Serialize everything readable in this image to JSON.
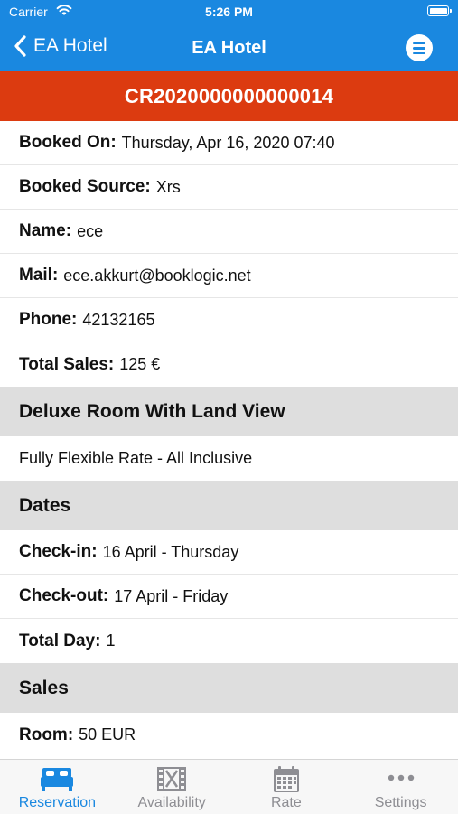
{
  "status_bar": {
    "carrier": "Carrier",
    "time": "5:26 PM"
  },
  "nav": {
    "back_label": "EA Hotel",
    "title": "EA Hotel"
  },
  "booking_code": "CR2020000000000014",
  "details": [
    {
      "key": "Booked On:",
      "value": "Thursday, Apr 16, 2020 07:40"
    },
    {
      "key": "Booked Source:",
      "value": "Xrs"
    },
    {
      "key": "Name:",
      "value": "ece"
    },
    {
      "key": "Mail:",
      "value": "ece.akkurt@booklogic.net"
    },
    {
      "key": "Phone:",
      "value": "42132165"
    },
    {
      "key": "Total Sales:",
      "value": "125 €"
    }
  ],
  "room": {
    "title": "Deluxe Room With Land View",
    "rate": "Fully Flexible Rate - All Inclusive"
  },
  "dates": {
    "title": "Dates",
    "items": [
      {
        "key": "Check-in:",
        "value": "16 April - Thursday"
      },
      {
        "key": "Check-out:",
        "value": "17 April - Friday"
      },
      {
        "key": "Total Day:",
        "value": "1"
      }
    ]
  },
  "sales": {
    "title": "Sales",
    "items": [
      {
        "key": "Room:",
        "value": "50 EUR"
      }
    ]
  },
  "tabs": [
    {
      "label": "Reservation",
      "icon": "bed-icon",
      "active": true
    },
    {
      "label": "Availability",
      "icon": "film-icon",
      "active": false
    },
    {
      "label": "Rate",
      "icon": "calendar-icon",
      "active": false
    },
    {
      "label": "Settings",
      "icon": "more-icon",
      "active": false
    }
  ],
  "colors": {
    "primary": "#1a88e0",
    "banner": "#dc3b10",
    "section_bg": "#dedede",
    "tab_inactive": "#8e8e93"
  }
}
